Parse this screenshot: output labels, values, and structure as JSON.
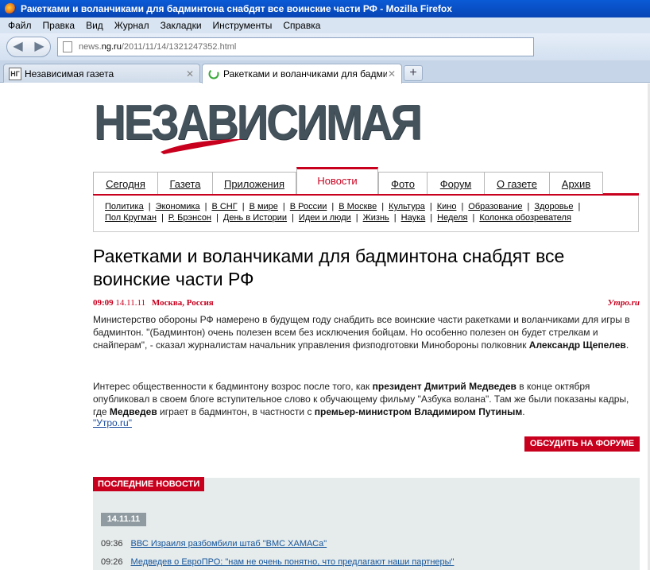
{
  "window": {
    "title": "Ракетками и воланчиками для бадминтона снабдят все воинские части РФ - Mozilla Firefox"
  },
  "menu": [
    "Файл",
    "Правка",
    "Вид",
    "Журнал",
    "Закладки",
    "Инструменты",
    "Справка"
  ],
  "url": {
    "domain_prefix": "news.",
    "domain": "ng.ru",
    "path": "/2011/11/14/1321247352.html"
  },
  "tabs": [
    {
      "favicon": "НГ",
      "label": "Независимая газета",
      "active": false
    },
    {
      "favicon": "loading-icon",
      "label": "Ракетками и воланчиками для бадминтона снабдят все ...",
      "active": true
    }
  ],
  "logo": {
    "text": "НЕЗАВИСИМАЯ"
  },
  "main_nav": [
    "Сегодня",
    "Газета",
    "Приложения",
    "Новости",
    "Фото",
    "Форум",
    "О газете",
    "Архив"
  ],
  "main_nav_active": "Новости",
  "sub_nav_row1": [
    "Политика",
    "Экономика",
    "В СНГ",
    "В мире",
    "В России",
    "В Москве",
    "Культура",
    "Кино",
    "Образование",
    "Здоровье"
  ],
  "sub_nav_row2": [
    "Пол Кругман",
    "Р. Брэнсон",
    "День в Истории",
    "Идеи и люди",
    "Жизнь",
    "Наука",
    "Неделя",
    "Колонка обозревателя"
  ],
  "article": {
    "headline": "Ракетками и воланчиками для бадминтона снабдят все воинские части РФ",
    "time": "09:09",
    "date": "14.11.11",
    "place": "Москва, Россия",
    "source": "Утро.ru",
    "p1_a": "Министерство обороны РФ намерено в будущем году снабдить все воинские части ракетками и воланчиками для игры в бадминтон. \"(Бадминтон) очень полезен всем без исключения бойцам. Но особенно полезен он будет стрелкам и снайперам\", - сказал журналистам начальник управления физподготовки Минобороны полковник ",
    "p1_b": "Александр Щепелев",
    "p1_c": ".",
    "p2_a": "Интерес общественности к бадминтону возрос после того, как ",
    "p2_b": "президент Дмитрий Медведев",
    "p2_c": " в конце октября опубликовал в своем блоге вступительное слово к обучающему фильму \"Азбука волана\". Там же были показаны кадры, где ",
    "p2_d": "Медведев",
    "p2_e": " играет в бадминтон, в частности с ",
    "p2_f": "премьер-министром Владимиром Путиным",
    "p2_g": ".",
    "source_link": "\"Утро.ru\"",
    "forum_button": "ОБСУДИТЬ НА ФОРУМЕ"
  },
  "latest": {
    "header": "ПОСЛЕДНИЕ НОВОСТИ",
    "date": "14.11.11",
    "items": [
      {
        "time": "09:36",
        "title": "ВВС Израиля разбомбили штаб \"ВМС ХАМАСа\""
      },
      {
        "time": "09:26",
        "title": "Медведев о ЕвроПРО: \"нам не очень понятно, что предлагают наши партнеры\""
      }
    ]
  },
  "colors": {
    "accent": "#c8001e",
    "link": "#16569a"
  }
}
